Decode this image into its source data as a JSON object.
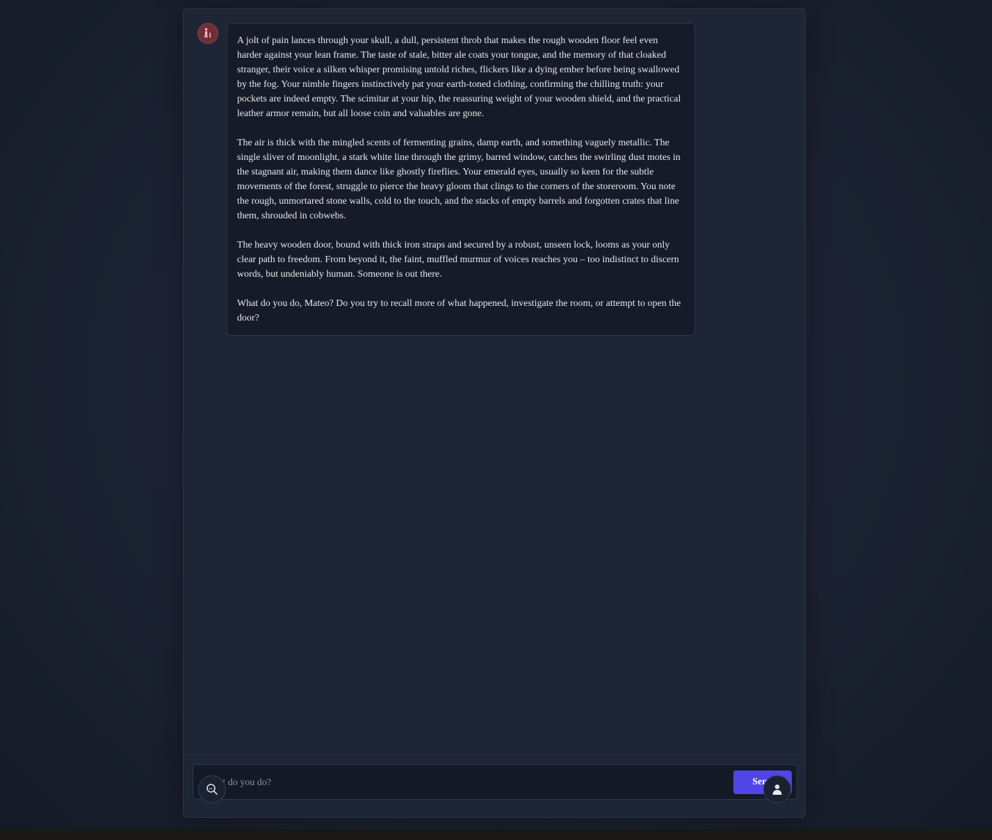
{
  "chat": {
    "assistant_avatar_icon": "adventurer-icon",
    "message_paragraphs": [
      "A jolt of pain lances through your skull, a dull, persistent throb that makes the rough wooden floor feel even harder against your lean frame. The taste of stale, bitter ale coats your tongue, and the memory of that cloaked stranger, their voice a silken whisper promising untold riches, flickers like a dying ember before being swallowed by the fog. Your nimble fingers instinctively pat your earth-toned clothing, confirming the chilling truth: your pockets are indeed empty. The scimitar at your hip, the reassuring weight of your wooden shield, and the practical leather armor remain, but all loose coin and valuables are gone.",
      "The air is thick with the mingled scents of fermenting grains, damp earth, and something vaguely metallic. The single sliver of moonlight, a stark white line through the grimy, barred window, catches the swirling dust motes in the stagnant air, making them dance like ghostly fireflies. Your emerald eyes, usually so keen for the subtle movements of the forest, struggle to pierce the heavy gloom that clings to the corners of the storeroom. You note the rough, unmortared stone walls, cold to the touch, and the stacks of empty barrels and forgotten crates that line them, shrouded in cobwebs.",
      "The heavy wooden door, bound with thick iron straps and secured by a robust, unseen lock, looms as your only clear path to freedom. From beyond it, the faint, muffled murmur of voices reaches you – too indistinct to discern words, but undeniably human. Someone is out there.",
      "What do you do, Mateo? Do you try to recall more of what happened, investigate the room, or attempt to open the door?"
    ]
  },
  "composer": {
    "placeholder": "What do you do?",
    "value": "",
    "send_label": "Send"
  },
  "floating_buttons": {
    "left_icon": "search-icon",
    "right_icon": "user-icon"
  },
  "colors": {
    "page_background": "#1b2231",
    "panel_background": "#1e2635",
    "bubble_background": "#151b28",
    "send_button": "#4f46e5",
    "avatar": "#6e2f38",
    "text": "#e6e8ec",
    "placeholder": "#8d94a3"
  }
}
